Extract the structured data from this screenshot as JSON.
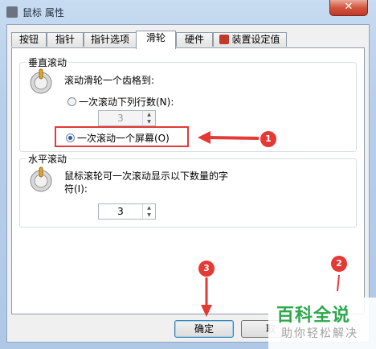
{
  "window": {
    "title": "鼠标 属性",
    "close_label": "✕"
  },
  "tabs": [
    {
      "label": "按钮"
    },
    {
      "label": "指针"
    },
    {
      "label": "指针选项"
    },
    {
      "label": "滑轮"
    },
    {
      "label": "硬件"
    },
    {
      "label": "装置设定值"
    }
  ],
  "active_tab": "滑轮",
  "vertical_scroll": {
    "title": "垂直滚动",
    "description": "滚动滑轮一个齿格到:",
    "option_lines": {
      "label": "一次滚动下列行数(N):",
      "checked": false
    },
    "lines_value": "3",
    "option_screen": {
      "label": "一次滚动一个屏幕(O)",
      "checked": true
    }
  },
  "horizontal_scroll": {
    "title": "水平滚动",
    "description_line1": "鼠标滚轮可一次滚动显示以下数量的字",
    "description_line2": "符(I):",
    "chars_value": "3"
  },
  "buttons": {
    "ok": "确定",
    "cancel": "取"
  },
  "annotations": {
    "marker1": "1",
    "marker2": "2",
    "marker3": "3",
    "color": "#e53935"
  },
  "watermark": {
    "title": "百科全说",
    "subtitle": "助你轻松解决"
  }
}
